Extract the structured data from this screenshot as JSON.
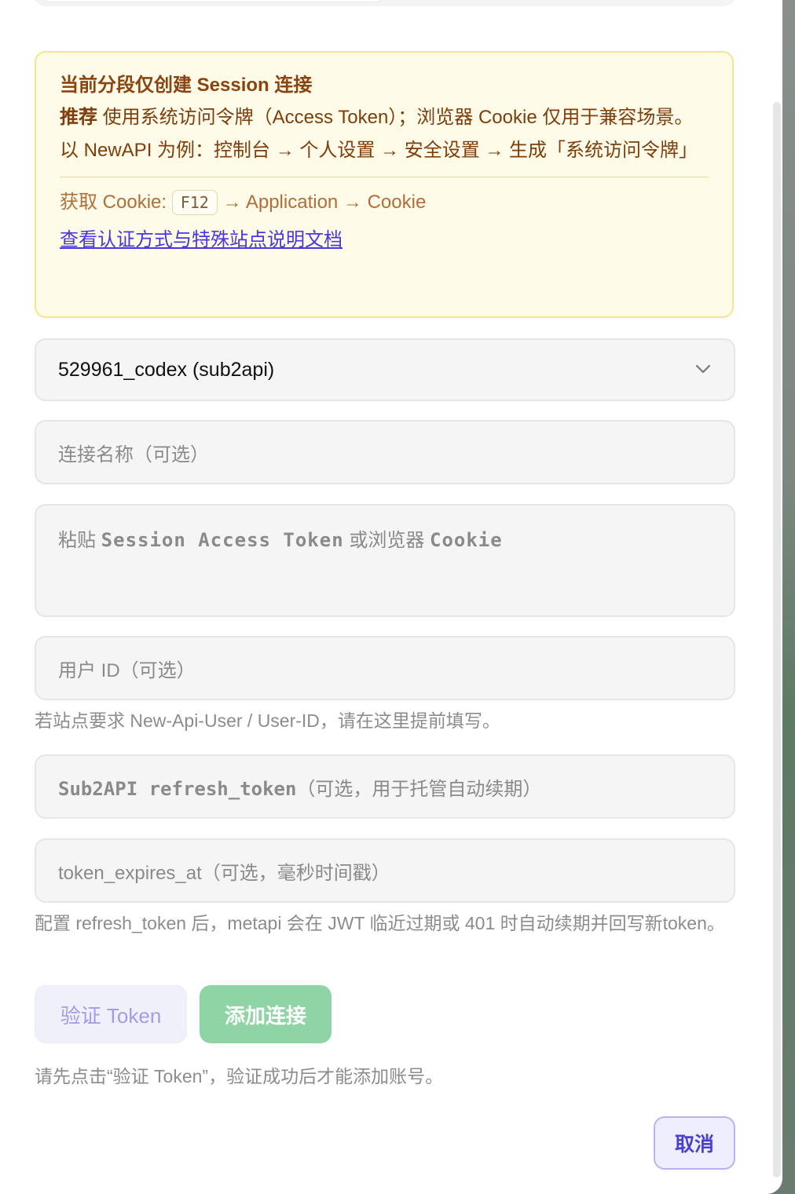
{
  "notice": {
    "title": "当前分段仅创建 Session 连接",
    "recommend_bold": "推荐",
    "recommend_text": " 使用系统访问令牌（Access Token）；浏览器 Cookie 仅用于兼容场景。",
    "example": "以 NewAPI 为例：控制台 → 个人设置 → 安全设置 → 生成「系统访问令牌」",
    "cookie_prefix": "获取 Cookie: ",
    "cookie_key": "F12",
    "cookie_suffix": " → Application → Cookie",
    "doc_link": "查看认证方式与特殊站点说明文档"
  },
  "form": {
    "site_select_value": "529961_codex (sub2api)",
    "connection_name_placeholder": "连接名称（可选）",
    "token_placeholder_a": "粘贴 ",
    "token_placeholder_mono1": "Session Access Token",
    "token_placeholder_b": " 或浏览器 ",
    "token_placeholder_mono2": "Cookie",
    "user_id_placeholder": "用户 ID（可选）",
    "user_id_hint": "若站点要求 New-Api-User / User-ID，请在这里提前填写。",
    "refresh_placeholder_mono": "Sub2API refresh_token",
    "refresh_placeholder_text": "（可选，用于托管自动续期）",
    "expires_placeholder": "token_expires_at（可选，毫秒时间戳）",
    "refresh_hint": "配置 refresh_token 后，metapi 会在 JWT 临近过期或 401 时自动续期并回写新token。"
  },
  "actions": {
    "verify_label": "验证 Token",
    "add_label": "添加连接",
    "verify_hint": "请先点击“验证 Token”，验证成功后才能添加账号。",
    "cancel_label": "取消"
  }
}
